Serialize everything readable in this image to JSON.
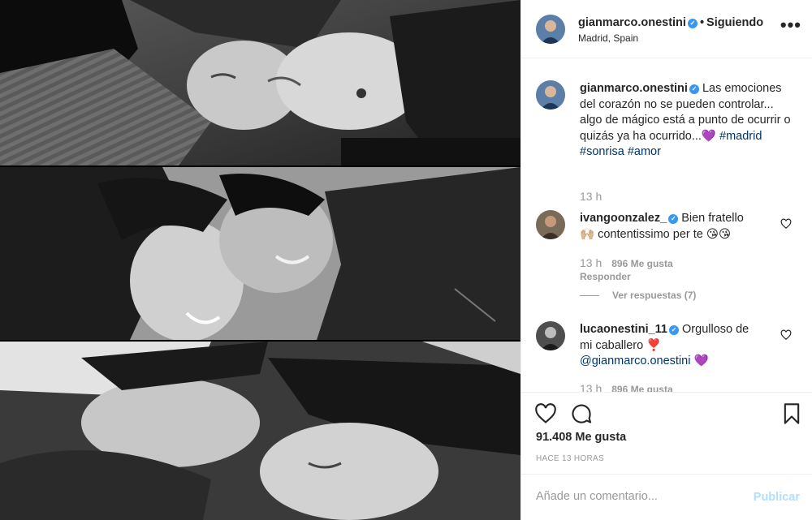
{
  "post": {
    "username": "gianmarco.onestini",
    "follow_separator": "•",
    "follow_status": "Siguiendo",
    "location": "Madrid, Spain",
    "more_label": "•••",
    "image_alt": "Collage de tres fotos en blanco y negro de una pareja"
  },
  "caption": {
    "username": "gianmarco.onestini",
    "text": "Las emociones del corazón no se pueden controlar... algo de mágico está a punto de ocurrir o quizás ya ha ocurrido...",
    "emoji": "💜",
    "hashtags": [
      "#madrid",
      "#sonrisa",
      "#amor"
    ],
    "time": "13 h"
  },
  "comments": [
    {
      "username": "ivangoonzalez_",
      "text_1": "Bien fratello",
      "text_2": "contentissimo per te",
      "emoji_1": "🙌🏼",
      "emoji_2": "😘😘",
      "time": "13 h",
      "likes": "896 Me gusta",
      "reply": "Responder",
      "view_replies": "Ver respuestas (7)"
    },
    {
      "username": "lucaonestini_11",
      "text_1": "Orgulloso de",
      "text_2": "mi caballero",
      "emoji_1": "❣️",
      "mention": "@gianmarco.onestini",
      "emoji_2": "💜",
      "time": "13 h",
      "likes": "896 Me gusta"
    }
  ],
  "actions": {
    "like_icon": "heart-icon",
    "comment_icon": "comment-bubble-icon",
    "save_icon": "bookmark-icon"
  },
  "stats": {
    "likes": "91.408 Me gusta",
    "time_ago": "HACE 13 HORAS"
  },
  "add_comment": {
    "placeholder": "Añade un comentario...",
    "publish_label": "Publicar"
  },
  "colors": {
    "link": "#003569",
    "verified": "#3897f0",
    "muted": "#999999",
    "publish_disabled": "#b2dffc"
  }
}
